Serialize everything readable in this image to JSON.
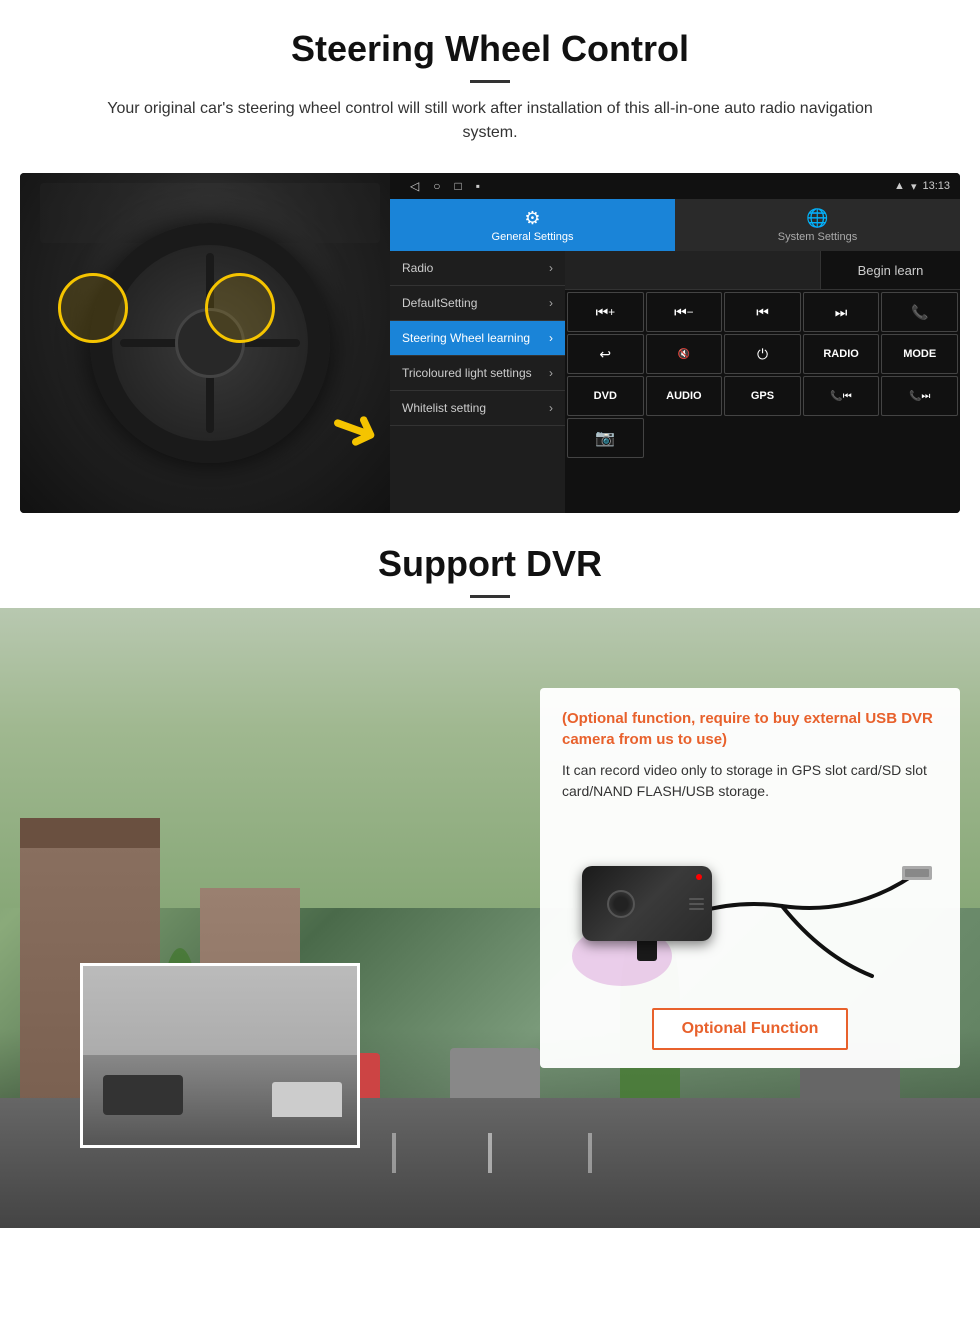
{
  "section1": {
    "title": "Steering Wheel Control",
    "description": "Your original car's steering wheel control will still work after installation of this all-in-one auto radio navigation system.",
    "status_bar": {
      "time": "13:13",
      "nav_icons": [
        "◁",
        "○",
        "□",
        "▪"
      ]
    },
    "tabs": [
      {
        "label": "General Settings",
        "icon": "⚙",
        "active": true
      },
      {
        "label": "System Settings",
        "icon": "🌐",
        "active": false
      }
    ],
    "menu_items": [
      {
        "label": "Radio",
        "active": false
      },
      {
        "label": "DefaultSetting",
        "active": false
      },
      {
        "label": "Steering Wheel learning",
        "active": true
      },
      {
        "label": "Tricoloured light settings",
        "active": false
      },
      {
        "label": "Whitelist setting",
        "active": false
      }
    ],
    "begin_learn": "Begin learn",
    "control_buttons": [
      "⏮+",
      "⏮−",
      "⏮⏮",
      "⏭⏭",
      "📞",
      "↩",
      "🔇",
      "⏻",
      "RADIO",
      "MODE",
      "DVD",
      "AUDIO",
      "GPS",
      "📞⏮",
      "📞⏭"
    ]
  },
  "section2": {
    "title": "Support DVR",
    "info_title": "(Optional function, require to buy external USB DVR camera from us to use)",
    "info_body": "It can record video only to storage in GPS slot card/SD slot card/NAND FLASH/USB storage.",
    "optional_button": "Optional Function"
  }
}
